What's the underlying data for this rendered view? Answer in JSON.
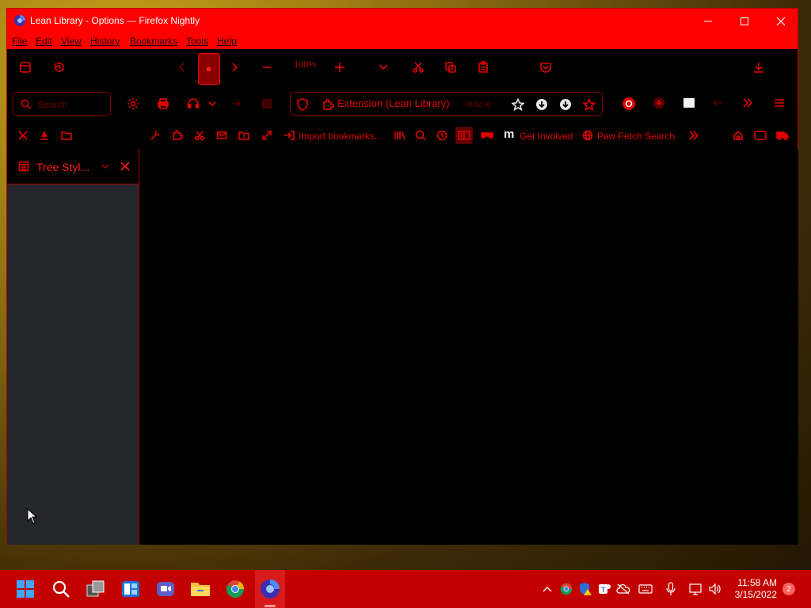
{
  "window": {
    "title": "Lean Library - Options — Firefox Nightly",
    "controls": [
      "minimize",
      "maximize",
      "close"
    ]
  },
  "menubar": {
    "items": [
      {
        "label": "File"
      },
      {
        "label": "Edit"
      },
      {
        "label": "View"
      },
      {
        "label": "History"
      },
      {
        "label": "Bookmarks"
      },
      {
        "label": "Tools"
      },
      {
        "label": "Help"
      }
    ]
  },
  "toolbar1": {
    "zoom_level": "100%",
    "icons": [
      "sidebar-icon",
      "history-icon",
      "back-arrow-icon",
      "tab-icon",
      "forward-arrow-icon",
      "zoom-out-icon",
      "zoom-in-icon",
      "chevron-down-icon",
      "cut-icon",
      "copy-icon",
      "paste-icon",
      "pocket-icon",
      "download-icon"
    ]
  },
  "toolbar2": {
    "search_placeholder": "Search",
    "url_identity": "Extension (Lean Library)",
    "url_text": "moz-e",
    "icons": [
      "settings-icon",
      "print-icon",
      "headphones-icon",
      "shield-icon",
      "puzzle-icon",
      "bookmark-star-icon",
      "download-circle-icon",
      "menu-icon"
    ]
  },
  "toolbar3": {
    "import_bookmarks": "Import bookmarks...",
    "get_involved": "Get Involved",
    "paw_fetch": "Paw Fetch Search",
    "mdn_letter": "m"
  },
  "sidebar": {
    "title": "Tree Styl..."
  },
  "taskbar": {
    "time": "11:58 AM",
    "date": "3/15/2022",
    "notification_count": "2"
  },
  "colors": {
    "accent": "#ff0000",
    "toolbar_bg": "#000000",
    "sidebar_bg": "#25252d",
    "taskbar_bg": "#c20000"
  }
}
